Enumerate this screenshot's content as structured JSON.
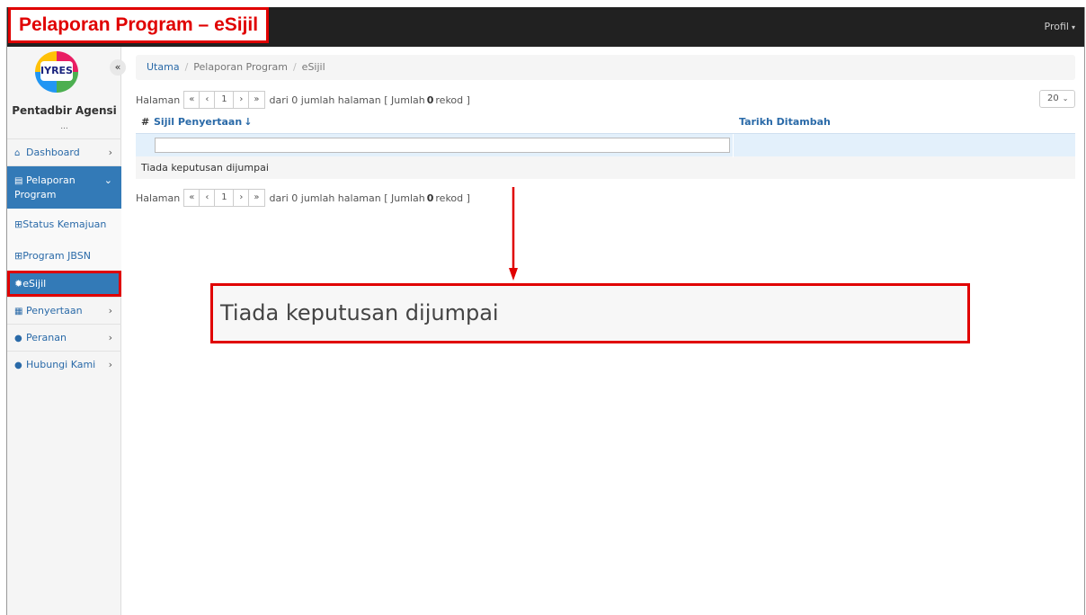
{
  "header": {
    "title_label": "Pelaporan Program – eSijil",
    "profile_label": "Profil",
    "profile_caret": "▾"
  },
  "sidebar": {
    "logo_text": "IYRES",
    "collapse_glyph": "«",
    "user_name": "Pentadbir Agensi",
    "user_ellipsis": "...",
    "items": [
      {
        "label": "Dashboard",
        "icon": "home-icon",
        "glyph": "⌂",
        "chevron": "›"
      },
      {
        "label": "Pelaporan Program",
        "icon": "book-icon",
        "glyph": "▤",
        "chevron": "⌄"
      },
      {
        "label": "Penyertaan",
        "icon": "clipboard-icon",
        "glyph": "▦",
        "chevron": "›"
      },
      {
        "label": "Peranan",
        "icon": "user-icon",
        "glyph": "●",
        "chevron": "›"
      },
      {
        "label": "Hubungi Kami",
        "icon": "chat-icon",
        "glyph": "●",
        "chevron": "›"
      }
    ],
    "subitems": [
      {
        "label": "Status Kemajuan",
        "icon": "table-icon",
        "glyph": "⊞"
      },
      {
        "label": "Program JBSN",
        "icon": "table-icon",
        "glyph": "⊞"
      },
      {
        "label": "eSijil",
        "icon": "certificate-icon",
        "glyph": "✹"
      }
    ]
  },
  "breadcrumb": {
    "home": "Utama",
    "level1": "Pelaporan Program",
    "current": "eSijil",
    "separator": "/"
  },
  "pager": {
    "label": "Halaman",
    "first": "«",
    "prev": "‹",
    "page": "1",
    "next": "›",
    "last": "»",
    "summary_pre": "dari 0 jumlah halaman [ Jumlah",
    "total": "0",
    "summary_post": "rekod ]",
    "per_page": "20",
    "per_page_caret": "⌄"
  },
  "table": {
    "hash": "#",
    "columns": [
      "Sijil Penyertaan",
      "Tarikh Ditambah"
    ],
    "sort_glyph": "↓",
    "empty_message": "Tiada keputusan dijumpai"
  },
  "callout": {
    "text": "Tiada keputusan dijumpai",
    "color": "#e00000"
  },
  "colors": {
    "accent": "#337ab7",
    "highlight": "#e00000",
    "topbar": "#212121"
  }
}
